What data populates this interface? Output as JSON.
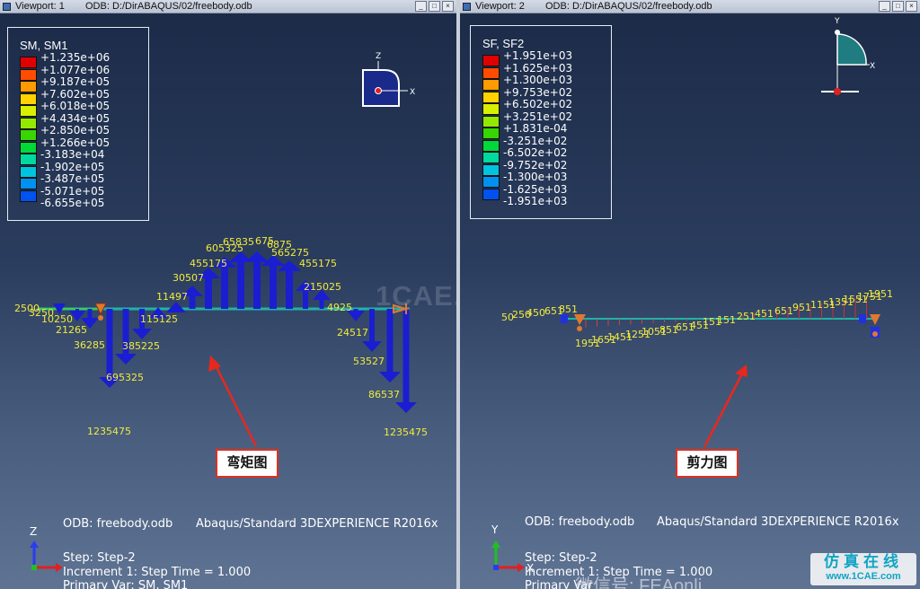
{
  "viewport1": {
    "title": "Viewport: 1",
    "odb": "ODB: D:/DirABAQUS/02/freebody.odb",
    "legend_title": "SM, SM1",
    "legend_values": [
      "+1.235e+06",
      "+1.077e+06",
      "+9.187e+05",
      "+7.602e+05",
      "+6.018e+05",
      "+4.434e+05",
      "+2.850e+05",
      "+1.266e+05",
      "-3.183e+04",
      "-1.902e+05",
      "-3.487e+05",
      "-5.071e+05",
      "-6.655e+05"
    ],
    "axis_z": "Z",
    "axis_x": "X",
    "labels": {
      "l2500": "2500",
      "l3250": "3250",
      "l10250": "10250",
      "l21265": "21265",
      "l36285": "36285",
      "l695325": "695325",
      "l1235475a": "1235475",
      "l385225": "385225",
      "l115125": "115125",
      "l11497": "11497",
      "l30507": "30507",
      "l455175a": "455175",
      "l605325": "605325",
      "l65": "65",
      "l835": "835",
      "l675": "675",
      "l6875": "6875",
      "l565275": "565275",
      "l455175b": "455175",
      "l215025": "215025",
      "l4925": "4925",
      "l24517": "24517",
      "l53527": "53527",
      "l86537": "86537",
      "l1235475b": "1235475"
    },
    "callout": "弯矩图",
    "footer": {
      "odb": "ODB: freebody.odb",
      "solver": "Abaqus/Standard 3DEXPERIENCE R2016x",
      "step": "Step: Step-2",
      "increment": "Increment     1: Step Time =     1.000",
      "primary_var": "Primary Var: SM, SM1"
    }
  },
  "viewport2": {
    "title": "Viewport: 2",
    "odb": "ODB: D:/DirABAQUS/02/freebody.odb",
    "legend_title": "SF, SF2",
    "legend_values": [
      "+1.951e+03",
      "+1.625e+03",
      "+1.300e+03",
      "+9.753e+02",
      "+6.502e+02",
      "+3.251e+02",
      "+1.831e-04",
      "-3.251e+02",
      "-6.502e+02",
      "-9.752e+02",
      "-1.300e+03",
      "-1.625e+03",
      "-1.951e+03"
    ],
    "axis_y": "Y",
    "axis_x": "X",
    "labels": {
      "top": [
        "50",
        "250",
        "450",
        "651",
        "851"
      ],
      "bottom": [
        "1951",
        "1651",
        "1451",
        "1251",
        "1051",
        "851",
        "651",
        "451",
        "151",
        "151"
      ],
      "right": [
        "251",
        "451",
        "651",
        "951",
        "1151",
        "1351",
        "1551",
        "1751",
        "1951"
      ]
    },
    "callout": "剪力图",
    "footer": {
      "odb": "ODB: freebody.odb",
      "solver": "Abaqus/Standard 3DEXPERIENCE R2016x",
      "step": "Step: Step-2",
      "increment": "Increment     1: Step Time =     1.000",
      "primary_var": "Primary Var"
    }
  },
  "legend_colors": [
    "#e10000",
    "#ff4c00",
    "#ff9a00",
    "#ffd200",
    "#d8f000",
    "#93ea00",
    "#38d600",
    "#00d93a",
    "#00d9a0",
    "#00c4df",
    "#0091f0",
    "#0052f0",
    "#0a16d4"
  ],
  "watermark": "1CAE.COM",
  "wechat_text": "微信号: FEAonli",
  "brand": {
    "cn": "仿真在线",
    "url": "www.1CAE.com"
  }
}
